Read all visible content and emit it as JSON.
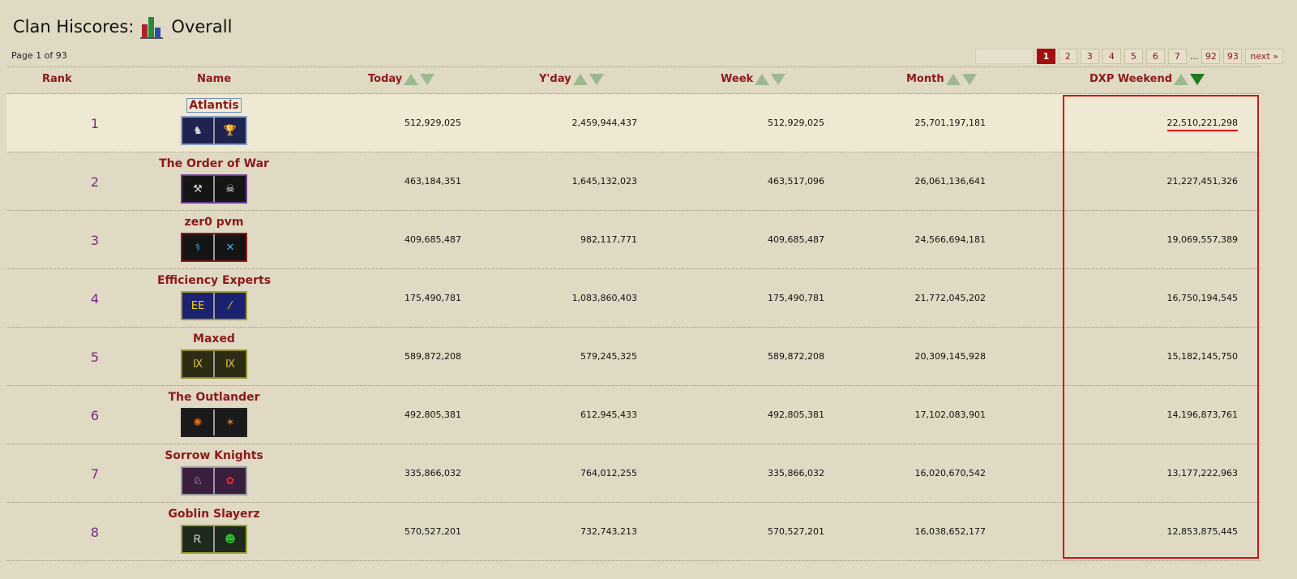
{
  "title": {
    "prefix": "Clan Hiscores:",
    "suffix": "Overall"
  },
  "page_info": "Page 1 of 93",
  "pagination": {
    "pages": [
      "1",
      "2",
      "3",
      "4",
      "5",
      "6",
      "7"
    ],
    "ellipsis": "...",
    "tail": [
      "92",
      "93"
    ],
    "next": "next »"
  },
  "headers": {
    "rank": "Rank",
    "name": "Name",
    "today": "Today",
    "yday": "Y'day",
    "week": "Week",
    "month": "Month",
    "dxp": "DXP Weekend"
  },
  "rows": [
    {
      "rank": "1",
      "name": "Atlantis",
      "today": "512,929,025",
      "yday": "2,459,944,437",
      "week": "512,929,025",
      "month": "25,701,197,181",
      "dxp": "22,510,221,298",
      "banner": {
        "border": "#8aa0c0",
        "bg1": "#1e2350",
        "bg2": "#1e2350",
        "icon1": "♞",
        "icon2": "🏆",
        "c1": "#ddd",
        "c2": "#ddd"
      }
    },
    {
      "rank": "2",
      "name": "The Order of War",
      "today": "463,184,351",
      "yday": "1,645,132,023",
      "week": "463,517,096",
      "month": "26,061,136,641",
      "dxp": "21,227,451,326",
      "banner": {
        "border": "#6a3a96",
        "bg1": "#151515",
        "bg2": "#151515",
        "icon1": "⚒",
        "icon2": "☠",
        "c1": "#ddd",
        "c2": "#eee"
      }
    },
    {
      "rank": "3",
      "name": "zer0 pvm",
      "today": "409,685,487",
      "yday": "982,117,771",
      "week": "409,685,487",
      "month": "24,566,694,181",
      "dxp": "19,069,557,389",
      "banner": {
        "border": "#8a1a1a",
        "bg1": "#141414",
        "bg2": "#141414",
        "icon1": "⚕",
        "icon2": "✕",
        "c1": "#38b6e8",
        "c2": "#38b6e8"
      }
    },
    {
      "rank": "4",
      "name": "Efficiency Experts",
      "today": "175,490,781",
      "yday": "1,083,860,403",
      "week": "175,490,781",
      "month": "21,772,045,202",
      "dxp": "16,750,194,545",
      "banner": {
        "border": "#9e9a32",
        "bg1": "#1b2370",
        "bg2": "#1b2370",
        "icon1": "EE",
        "icon2": "⁄",
        "c1": "#f0d000",
        "c2": "#f0d000"
      }
    },
    {
      "rank": "5",
      "name": "Maxed",
      "today": "589,872,208",
      "yday": "579,245,325",
      "week": "589,872,208",
      "month": "20,309,145,928",
      "dxp": "15,182,145,750",
      "banner": {
        "border": "#8e8a22",
        "bg1": "#2c2c14",
        "bg2": "#2c2c14",
        "icon1": "Ⅸ",
        "icon2": "Ⅸ",
        "c1": "#e0c040",
        "c2": "#e0c040"
      }
    },
    {
      "rank": "6",
      "name": "The Outlander",
      "today": "492,805,381",
      "yday": "612,945,433",
      "week": "492,805,381",
      "month": "17,102,083,901",
      "dxp": "14,196,873,761",
      "banner": {
        "border": "#222",
        "bg1": "#1a1a1a",
        "bg2": "#1a1a1a",
        "icon1": "✺",
        "icon2": "✶",
        "c1": "#e07020",
        "c2": "#d08040"
      }
    },
    {
      "rank": "7",
      "name": "Sorrow Knights",
      "today": "335,866,032",
      "yday": "764,012,255",
      "week": "335,866,032",
      "month": "16,020,670,542",
      "dxp": "13,177,222,963",
      "banner": {
        "border": "#999",
        "bg1": "#3a1e3e",
        "bg2": "#3a1e3e",
        "icon1": "♘",
        "icon2": "✿",
        "c1": "#eee",
        "c2": "#e03030"
      }
    },
    {
      "rank": "8",
      "name": "Goblin Slayerz",
      "today": "570,527,201",
      "yday": "732,743,213",
      "week": "570,527,201",
      "month": "16,038,652,177",
      "dxp": "12,853,875,445",
      "banner": {
        "border": "#9aaa30",
        "bg1": "#1e2a1e",
        "bg2": "#1e2a1e",
        "icon1": "Ꭱ",
        "icon2": "☻",
        "c1": "#ddd",
        "c2": "#30c030"
      }
    }
  ]
}
